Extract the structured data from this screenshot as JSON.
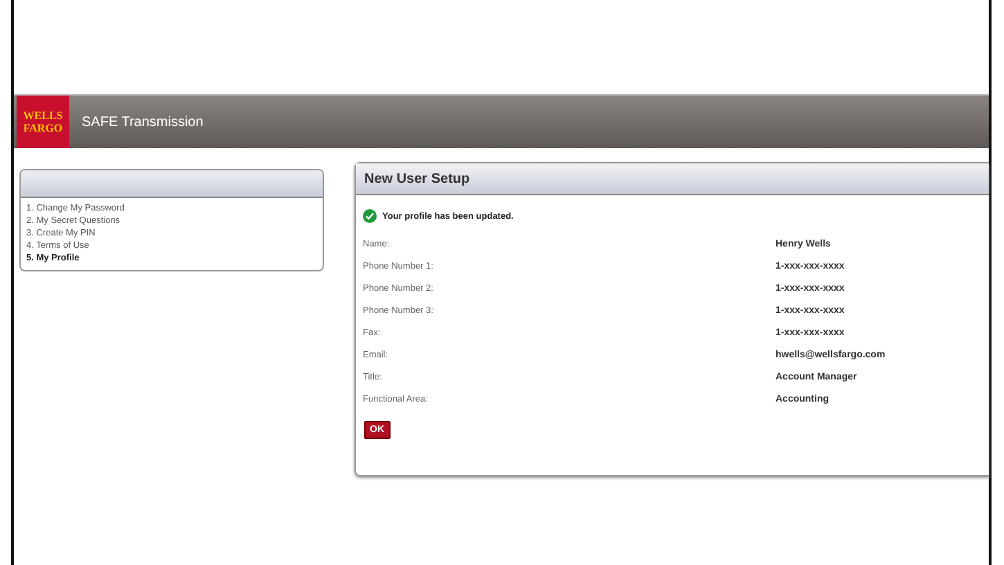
{
  "header": {
    "logo_lines": [
      "WELLS",
      "FARGO"
    ],
    "title": "SAFE Transmission"
  },
  "sidebar": {
    "items": [
      {
        "label": "1. Change My Password",
        "selected": false
      },
      {
        "label": "2. My Secret Questions",
        "selected": false
      },
      {
        "label": "3. Create My PIN",
        "selected": false
      },
      {
        "label": "4. Terms of Use",
        "selected": false
      },
      {
        "label": "5. My Profile",
        "selected": true
      }
    ]
  },
  "panel": {
    "title": "New User Setup",
    "message": "Your profile has been updated.",
    "fields": [
      {
        "label": "Name:",
        "value": "Henry Wells"
      },
      {
        "label": "Phone Number 1:",
        "value": "1-xxx-xxx-xxxx"
      },
      {
        "label": "Phone Number 2:",
        "value": "1-xxx-xxx-xxxx"
      },
      {
        "label": "Phone Number 3:",
        "value": "1-xxx-xxx-xxxx"
      },
      {
        "label": "Fax:",
        "value": "1-xxx-xxx-xxxx"
      },
      {
        "label": "Email:",
        "value": "hwells@wellsfargo.com"
      },
      {
        "label": "Title:",
        "value": "Account Manager"
      },
      {
        "label": "Functional Area:",
        "value": "Accounting"
      }
    ],
    "button": "OK"
  }
}
